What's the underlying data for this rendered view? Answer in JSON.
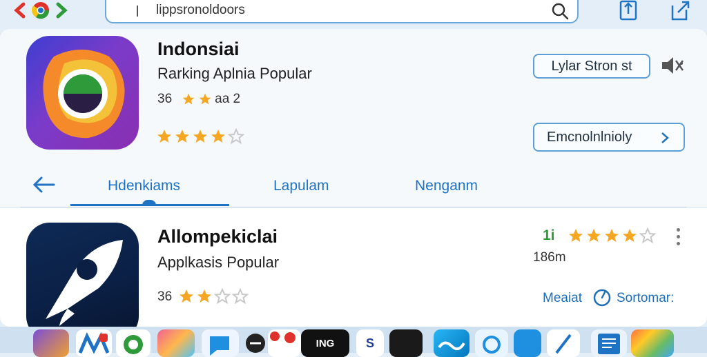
{
  "browser": {
    "url": "lippsronoldoors",
    "icons": [
      "back-arrow-icon",
      "browser-logo-icon",
      "forward-arrow-icon",
      "search-icon",
      "share-icon",
      "export-icon"
    ]
  },
  "colors": {
    "accent": "#1f73c4",
    "star": "#f5a623",
    "star_empty": "#c8c8c8",
    "rating_green": "#2e9a3a"
  },
  "app1": {
    "name": "Indonsiai",
    "subtitle": "Rarking Aplnia Popular",
    "meta_prefix": "36",
    "meta_suffix": "aa 2",
    "rating": 4,
    "button_top": "Lylar Stron st",
    "button_bottom": "Emcnolnlnioly",
    "bottom_button_icon": "chevron-right-icon",
    "side_icon": "mute-speaker-icon"
  },
  "tabs": {
    "back_icon": "back-arrow-icon",
    "items": [
      "Hdenkiams",
      "Lapulam",
      "Nenganm"
    ],
    "active": 0
  },
  "app2": {
    "name": "Allompekiclai",
    "subtitle": "Applkasis Popular",
    "meta_prefix": "36",
    "rating_small": 2,
    "rank": "1i",
    "rating": 4,
    "count": "186m",
    "link1": "Meaiat",
    "link2": "Sortomar:",
    "more_icon": "more-vertical-icon"
  },
  "dock": {
    "icons": [
      "photos-icon",
      "mail-icon",
      "maps-icon",
      "gallery-icon",
      "messenger-icon",
      "music-icon",
      "notes-icon",
      "news-icon",
      "app-icon",
      "tv-icon",
      "weather-icon",
      "camera-icon",
      "safari-icon",
      "calendar-icon",
      "photos-app-icon"
    ],
    "badge_text": "ING",
    "badge_text2": "S"
  }
}
